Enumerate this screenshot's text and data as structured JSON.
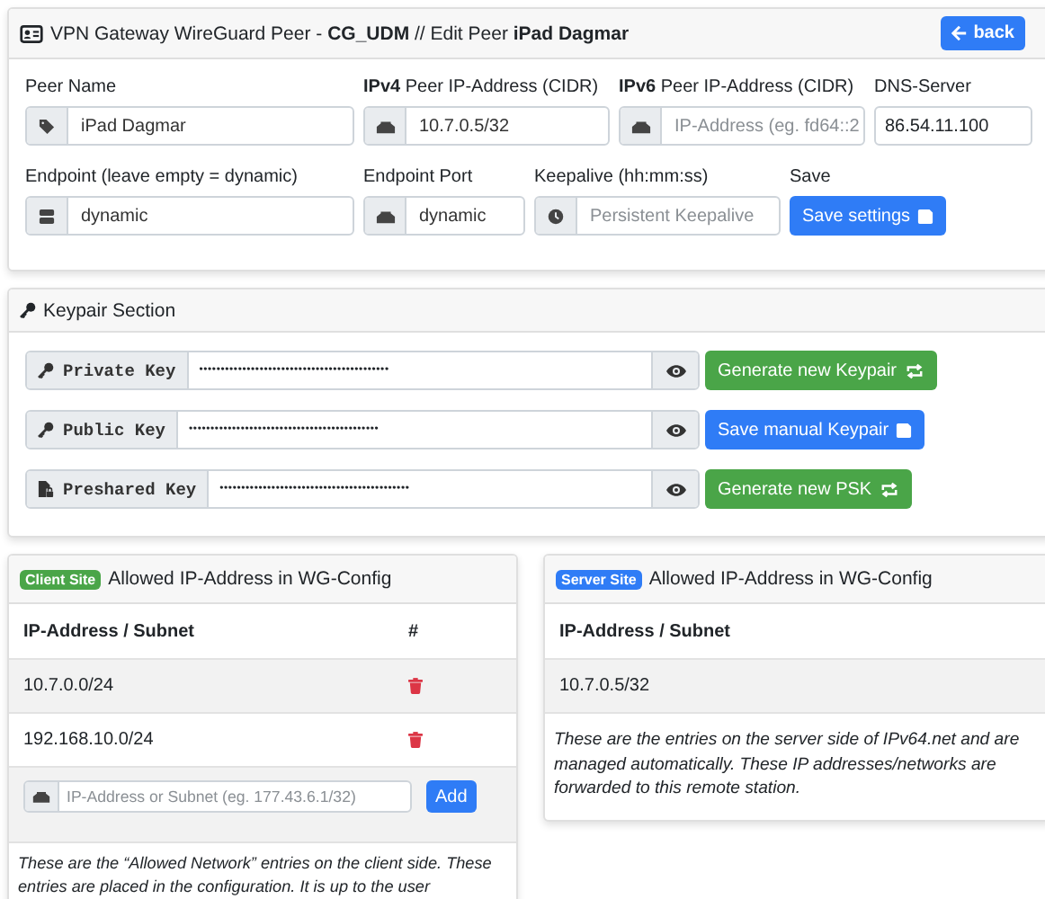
{
  "header": {
    "title": "VPN Gateway WireGuard Peer - **CG_UDM** // Edit Peer **iPad Dagmar**",
    "back_button": "back"
  },
  "settings": [
    {
      "label": "Peer Name",
      "kind": "tag",
      "value": "iPad Dagmar"
    },
    {
      "label": "**IPv4** Peer IP-Address (CIDR)",
      "kind": "network",
      "value": "10.7.0.5/32"
    },
    {
      "label": "**IPv6** Peer IP-Address (CIDR)",
      "kind": "network",
      "placeholder": "IP-Address (eg. fd64::2"
    },
    {
      "label": "DNS-Server",
      "kind": "plain",
      "value": "86.54.11.100"
    },
    {
      "label": "Endpoint (leave empty = dynamic)",
      "kind": "server",
      "value": "dynamic"
    },
    {
      "label": "Endpoint Port",
      "kind": "network",
      "value": "dynamic"
    },
    {
      "label": "Keepalive (hh:mm:ss)",
      "kind": "clock",
      "placeholder": "Persistent Keepalive"
    },
    {
      "label": "Save",
      "kind": "button",
      "button": "Save settings"
    }
  ],
  "keypair": {
    "title": "Keypair Section",
    "keys": [
      {
        "label": "Private Key",
        "kind": "key",
        "value": "••••••••••••••••••••••••••••••••••••••••••••",
        "button": {
          "label": "Generate new Keypair",
          "kind": "generate"
        }
      },
      {
        "label": "Public Key",
        "kind": "key",
        "value": "••••••••••••••••••••••••••••••••••••••••••••",
        "button": {
          "label": "Save manual Keypair",
          "kind": "save"
        }
      },
      {
        "label": "Preshared Key",
        "kind": "file",
        "value": "••••••••••••••••••••••••••••••••••••••••••••",
        "button": {
          "label": "Generate new PSK",
          "kind": "generate"
        }
      }
    ]
  },
  "client_site": {
    "badge": "Client Site",
    "title": "Allowed IP-Address in WG-Config",
    "columns": [
      "IP-Address / Subnet",
      "#"
    ],
    "rows": [
      "10.7.0.0/24",
      "192.168.10.0/24"
    ],
    "add_placeholder": "IP-Address or Subnet (eg. 177.43.6.1/32)",
    "add_button": "Add",
    "note": "These are the “Allowed Network” entries on the client side. These entries are placed in the configuration. It is up to the user"
  },
  "server_site": {
    "badge": "Server Site",
    "title": "Allowed IP-Address in WG-Config",
    "columns": [
      "IP-Address / Subnet"
    ],
    "rows": [
      "10.7.0.5/32"
    ],
    "note": "These are the entries on the server side of IPv64.net and are managed automatically. These IP addresses/networks are forwarded to this remote station."
  }
}
